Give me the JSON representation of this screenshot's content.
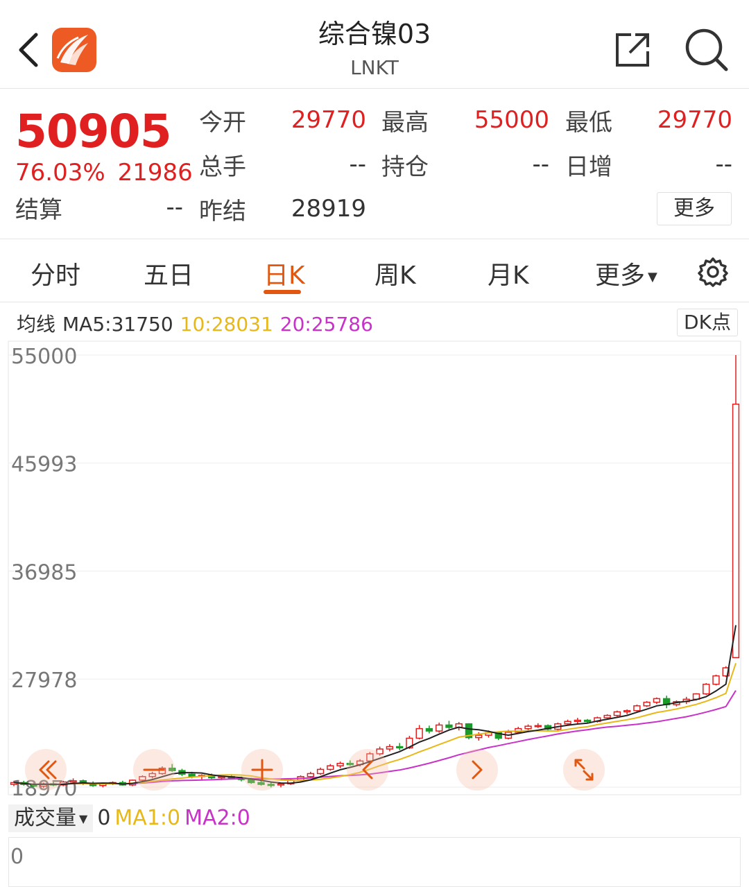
{
  "header": {
    "title": "综合镍03",
    "subtitle": "LNKT"
  },
  "quote": {
    "price": "50905",
    "change_pct": "76.03%",
    "change_abs": "21986",
    "settle_label": "结算",
    "settle_value": "--",
    "fields": [
      {
        "label": "今开",
        "value": "29770",
        "color": "red"
      },
      {
        "label": "最高",
        "value": "55000",
        "color": "red"
      },
      {
        "label": "最低",
        "value": "29770",
        "color": "red"
      },
      {
        "label": "总手",
        "value": "--",
        "color": "dark"
      },
      {
        "label": "持仓",
        "value": "--",
        "color": "dark"
      },
      {
        "label": "日增",
        "value": "--",
        "color": "dark"
      },
      {
        "label": "昨结",
        "value": "28919",
        "color": "dark"
      }
    ],
    "more_label": "更多"
  },
  "tabs": {
    "items": [
      "分时",
      "五日",
      "日K",
      "周K",
      "月K",
      "更多"
    ],
    "active": "日K"
  },
  "ma_legend": {
    "label": "均线",
    "ma5": "MA5:31750",
    "ma10": "10:28031",
    "ma20": "20:25786",
    "dk_label": "DK点"
  },
  "colors": {
    "up": "#e02020",
    "down": "#1a9a28",
    "accent": "#e2570f",
    "ma5": "#222222",
    "ma10": "#e8b817",
    "ma20": "#c832c8"
  },
  "chart_data": {
    "type": "candlestick",
    "y_axis_labels": [
      "55000",
      "45993",
      "36985",
      "27978",
      "18970"
    ],
    "ylim": [
      18970,
      55000
    ],
    "grid": true,
    "candles_ohlc": [
      [
        19200,
        19450,
        19050,
        19350
      ],
      [
        19350,
        19500,
        19100,
        19200
      ],
      [
        19200,
        19300,
        18950,
        19050
      ],
      [
        19050,
        19350,
        18900,
        19250
      ],
      [
        19250,
        19400,
        19050,
        19150
      ],
      [
        19150,
        19500,
        19050,
        19400
      ],
      [
        19400,
        19700,
        19250,
        19500
      ],
      [
        19500,
        19600,
        19150,
        19300
      ],
      [
        19300,
        19450,
        19000,
        19100
      ],
      [
        19100,
        19300,
        18950,
        19250
      ],
      [
        19250,
        19450,
        19150,
        19350
      ],
      [
        19350,
        19500,
        19100,
        19150
      ],
      [
        19150,
        19600,
        19050,
        19550
      ],
      [
        19550,
        19950,
        19450,
        19850
      ],
      [
        19850,
        20250,
        19700,
        20100
      ],
      [
        20100,
        20700,
        20000,
        20550
      ],
      [
        20550,
        20900,
        20250,
        20350
      ],
      [
        20350,
        20500,
        19900,
        20050
      ],
      [
        20050,
        20250,
        19700,
        19850
      ],
      [
        19850,
        20050,
        19600,
        19950
      ],
      [
        19950,
        20100,
        19650,
        19750
      ],
      [
        19750,
        19950,
        19550,
        19850
      ],
      [
        19850,
        20050,
        19650,
        19700
      ],
      [
        19700,
        19850,
        19450,
        19600
      ],
      [
        19600,
        19750,
        19250,
        19350
      ],
      [
        19350,
        19550,
        19100,
        19200
      ],
      [
        19200,
        19400,
        18950,
        19150
      ],
      [
        19150,
        19350,
        18950,
        19250
      ],
      [
        19250,
        19650,
        19150,
        19550
      ],
      [
        19550,
        19950,
        19450,
        19850
      ],
      [
        19850,
        20250,
        19750,
        20100
      ],
      [
        20100,
        20600,
        20000,
        20450
      ],
      [
        20450,
        20900,
        20350,
        20750
      ],
      [
        20750,
        21100,
        20550,
        20950
      ],
      [
        20950,
        21200,
        20750,
        20850
      ],
      [
        20850,
        21300,
        20700,
        21150
      ],
      [
        21150,
        21900,
        21050,
        21750
      ],
      [
        21750,
        22350,
        21600,
        22150
      ],
      [
        22150,
        22550,
        21950,
        22350
      ],
      [
        22350,
        22650,
        22050,
        22250
      ],
      [
        22250,
        23250,
        22150,
        23050
      ],
      [
        23050,
        24150,
        22950,
        23850
      ],
      [
        23850,
        24100,
        23450,
        23650
      ],
      [
        23650,
        24350,
        23500,
        24150
      ],
      [
        24150,
        24500,
        23800,
        23950
      ],
      [
        23950,
        24400,
        23700,
        24250
      ],
      [
        24250,
        24300,
        22950,
        23100
      ],
      [
        23100,
        23550,
        22850,
        23300
      ],
      [
        23300,
        23700,
        23100,
        23500
      ],
      [
        23500,
        23600,
        22900,
        23050
      ],
      [
        23050,
        23750,
        22950,
        23550
      ],
      [
        23550,
        24000,
        23450,
        23850
      ],
      [
        23850,
        24200,
        23600,
        24050
      ],
      [
        24050,
        24300,
        23900,
        24100
      ],
      [
        24100,
        24200,
        23650,
        23800
      ],
      [
        23800,
        24350,
        23700,
        24250
      ],
      [
        24250,
        24600,
        24100,
        24450
      ],
      [
        24450,
        24750,
        24250,
        24550
      ],
      [
        24550,
        24650,
        24350,
        24450
      ],
      [
        24450,
        24850,
        24350,
        24750
      ],
      [
        24750,
        25050,
        24650,
        24950
      ],
      [
        24950,
        25350,
        24850,
        25250
      ],
      [
        25250,
        25450,
        25050,
        25350
      ],
      [
        25350,
        25850,
        25250,
        25750
      ],
      [
        25750,
        26150,
        25650,
        26050
      ],
      [
        26050,
        26450,
        25900,
        26350
      ],
      [
        26350,
        26600,
        25550,
        25850
      ],
      [
        25850,
        26200,
        25700,
        26100
      ],
      [
        26100,
        26500,
        25900,
        26300
      ],
      [
        26300,
        26800,
        26200,
        26750
      ],
      [
        26750,
        27650,
        26650,
        27550
      ],
      [
        27550,
        28350,
        27450,
        28250
      ],
      [
        28250,
        29050,
        28150,
        28919
      ],
      [
        29770,
        55000,
        29770,
        50905
      ]
    ],
    "series": [
      {
        "name": "MA5",
        "value": 31750
      },
      {
        "name": "MA10",
        "value": 28031
      },
      {
        "name": "MA20",
        "value": 25786
      }
    ]
  },
  "chart_overlay": {
    "left_icon": "double-chevron-left-icon",
    "mid_icon_1": "minus-icon",
    "mid_icon_2": "plus-icon",
    "back_icon": "chevron-left-icon",
    "forward_icon": "chevron-right-icon",
    "expand_icon": "expand-icon"
  },
  "volume": {
    "selector_label": "成交量",
    "value": "0",
    "ma1": "MA1:0",
    "ma2": "MA2:0",
    "axis_zero": "0"
  }
}
